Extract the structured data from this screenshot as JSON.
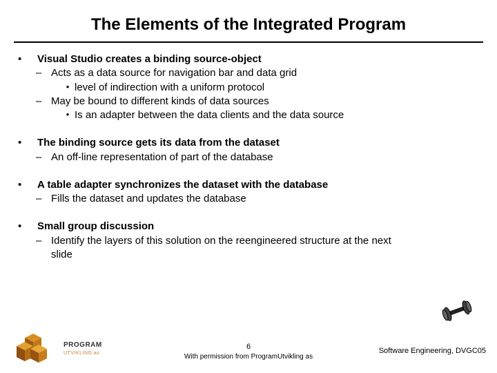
{
  "title": "The Elements of the Integrated Program",
  "bullets": [
    {
      "text": "Visual Studio creates a binding source-object",
      "children": [
        {
          "text": "Acts as a data source for navigation bar and data grid",
          "children": [
            {
              "text": "level of indirection with a uniform protocol"
            }
          ]
        },
        {
          "text": "May be bound to different kinds of data sources",
          "children": [
            {
              "text": "Is an adapter between the data clients and the data source"
            }
          ]
        }
      ]
    },
    {
      "text": "The binding source gets its data from the dataset",
      "children": [
        {
          "text": "An off-line representation of part of the database"
        }
      ]
    },
    {
      "text": "A table adapter synchronizes the dataset with the database",
      "children": [
        {
          "text": "Fills the dataset and updates the database"
        }
      ]
    },
    {
      "text": "Small group discussion",
      "children": [
        {
          "text": "Identify the layers of this solution on the reengineered structure at the next slide"
        }
      ]
    }
  ],
  "footer": {
    "logo_line1": "PROGRAM",
    "logo_line2": "UTVIKLING as",
    "page": "6",
    "permission": "With permission from ProgramUtvikling as",
    "course": "Software Engineering, DVGC05"
  }
}
